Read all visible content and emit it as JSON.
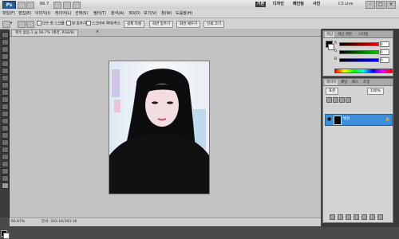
{
  "app": {
    "logo": "Ps",
    "zoom": "66.7",
    "workspaces": [
      "기본",
      "디자인",
      "페인팅",
      "사진"
    ],
    "cs_live": "CS Live",
    "window_buttons": [
      "-",
      "□",
      "×"
    ]
  },
  "menubar": {
    "items": [
      "파일(F)",
      "편집(E)",
      "이미지(I)",
      "레이어(L)",
      "선택(S)",
      "필터(T)",
      "분석(A)",
      "3D(D)",
      "보기(V)",
      "창(W)",
      "도움말(H)"
    ]
  },
  "options": {
    "sample_label": "▾",
    "check1": "모든 창 스크롤",
    "check2": "창 맞추기",
    "check3": "스크러비 확대/축소",
    "buttons": [
      "실제 픽셀",
      "화면 맞추기",
      "화면 채우기",
      "인쇄 크기"
    ]
  },
  "document": {
    "tab_label": "제목 없음-1 @ 66.7% (배경, RGB/8)",
    "close": "×",
    "status_zoom": "66.67%",
    "status_doc": "문서: 303.1K/303.1K"
  },
  "panels": {
    "color_tabs": [
      "색상",
      "색상 견본",
      "스타일"
    ],
    "sliders": [
      {
        "label": "R",
        "value": "0",
        "color": "#ff0000"
      },
      {
        "label": "G",
        "value": "0",
        "color": "#00c000"
      },
      {
        "label": "B",
        "value": "0",
        "color": "#0000ff"
      }
    ],
    "layer_tabs": [
      "레이어",
      "채널",
      "패스",
      "조정"
    ],
    "blend_mode": "표준",
    "opacity": "100%",
    "layer_name": "배경",
    "lock_icon": "🔒"
  },
  "colors": {
    "selected_layer": "#3d8fdb",
    "canvas_bg": "#c3c3c3",
    "workspace_active": "#3a3a3a"
  }
}
